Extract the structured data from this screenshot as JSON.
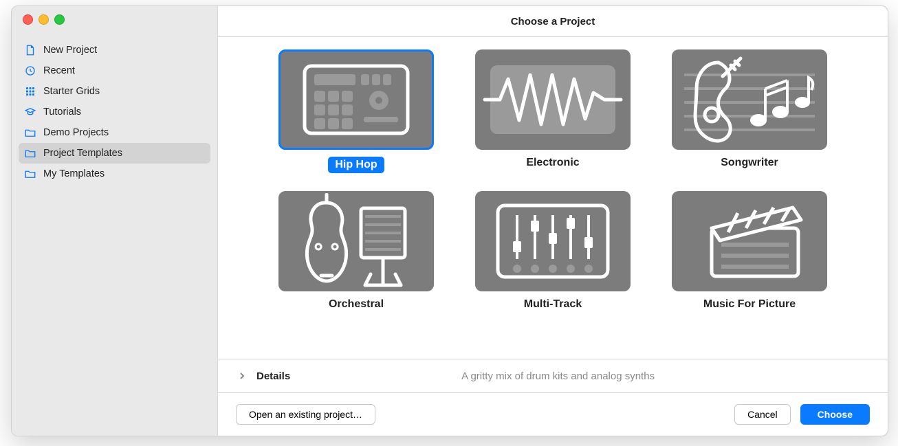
{
  "title": "Choose a Project",
  "sidebar": {
    "items": [
      {
        "label": "New Project",
        "icon": "file-icon"
      },
      {
        "label": "Recent",
        "icon": "clock-icon"
      },
      {
        "label": "Starter Grids",
        "icon": "grid-icon"
      },
      {
        "label": "Tutorials",
        "icon": "mortarboard-icon"
      },
      {
        "label": "Demo Projects",
        "icon": "folder-icon"
      },
      {
        "label": "Project Templates",
        "icon": "folder-icon",
        "selected": true
      },
      {
        "label": "My Templates",
        "icon": "folder-icon"
      }
    ]
  },
  "templates": [
    {
      "label": "Hip Hop",
      "icon": "drum-machine-icon",
      "selected": true
    },
    {
      "label": "Electronic",
      "icon": "waveform-icon"
    },
    {
      "label": "Songwriter",
      "icon": "guitar-notes-icon"
    },
    {
      "label": "Orchestral",
      "icon": "violin-stand-icon"
    },
    {
      "label": "Multi-Track",
      "icon": "mixer-icon"
    },
    {
      "label": "Music For Picture",
      "icon": "clapper-icon"
    }
  ],
  "details": {
    "label": "Details",
    "description": "A gritty mix of drum kits and analog synths"
  },
  "footer": {
    "open_existing": "Open an existing project…",
    "cancel": "Cancel",
    "choose": "Choose"
  }
}
